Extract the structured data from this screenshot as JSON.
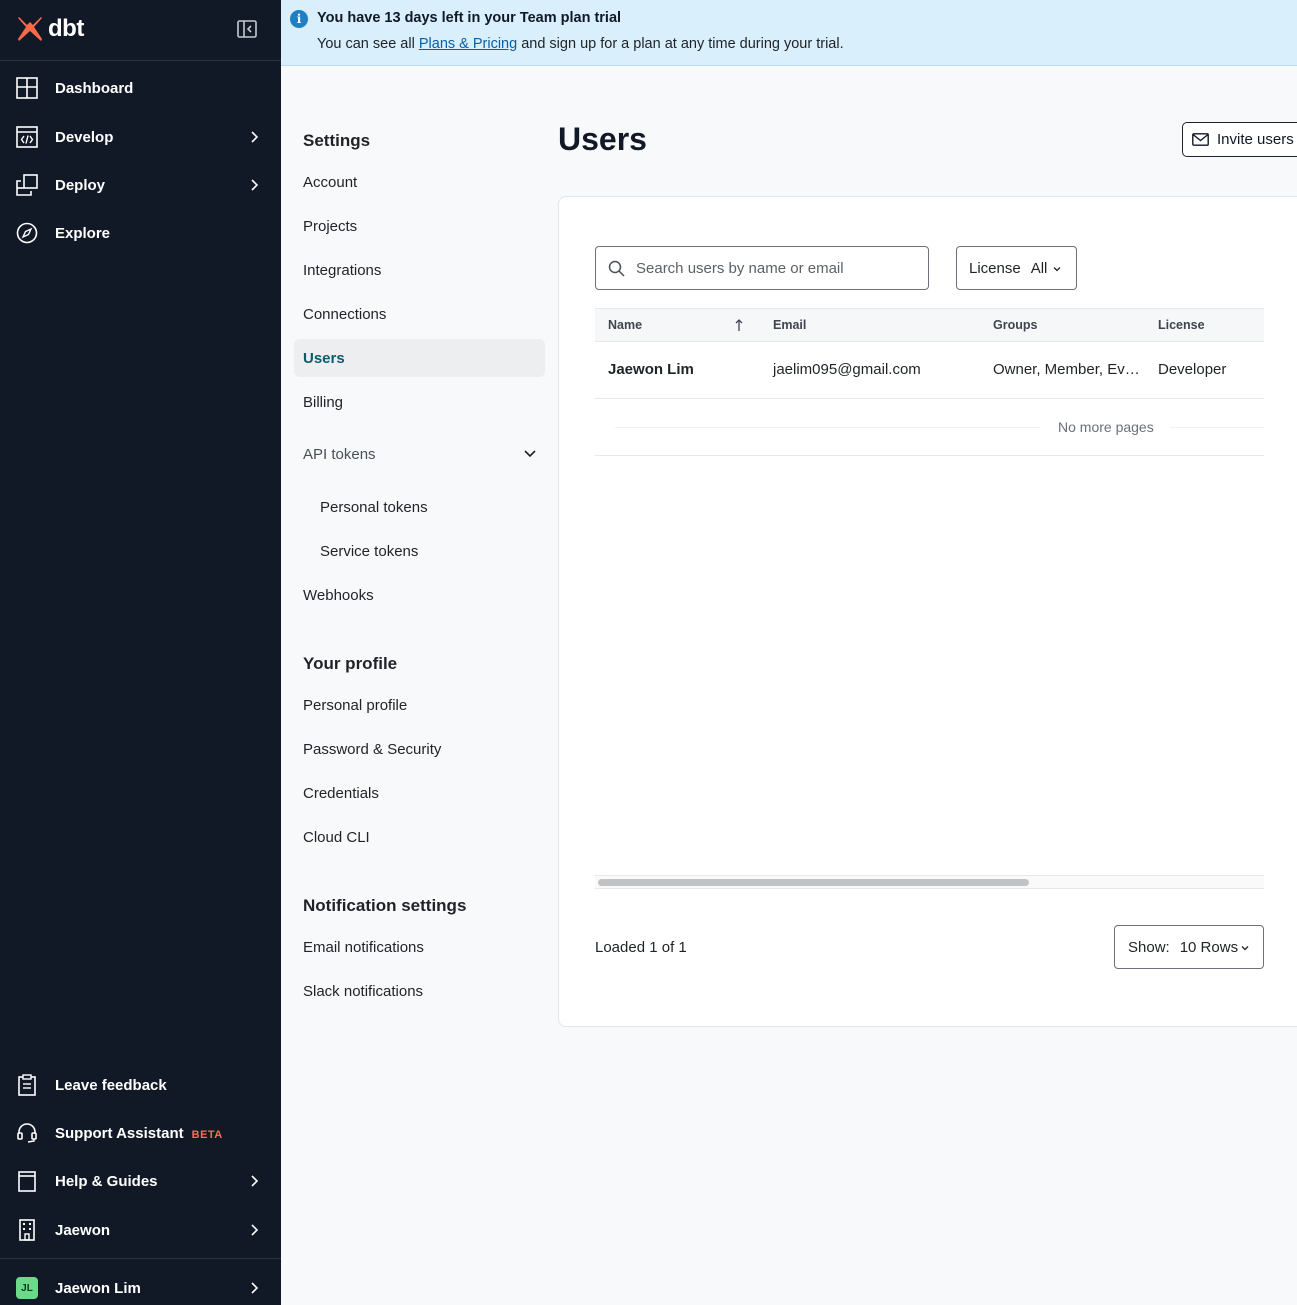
{
  "brand": {
    "name": "dbt",
    "accent": "#ff694a"
  },
  "sidebar": {
    "top_items": [
      {
        "label": "Dashboard",
        "icon": "dashboard-icon",
        "has_chevron": false
      },
      {
        "label": "Develop",
        "icon": "code-icon",
        "has_chevron": true
      },
      {
        "label": "Deploy",
        "icon": "deploy-icon",
        "has_chevron": true
      },
      {
        "label": "Explore",
        "icon": "compass-icon",
        "has_chevron": false
      }
    ],
    "bottom_items": [
      {
        "label": "Leave feedback",
        "icon": "clipboard-icon"
      },
      {
        "label": "Support Assistant",
        "icon": "headset-icon",
        "badge": "BETA"
      },
      {
        "label": "Help & Guides",
        "icon": "book-icon"
      },
      {
        "label": "Jaewon",
        "icon": "building-icon"
      }
    ],
    "user": {
      "initials": "JL",
      "name": "Jaewon Lim"
    }
  },
  "banner": {
    "title": "You have 13 days left in your Team plan trial",
    "text_before": "You can see all ",
    "link": "Plans & Pricing",
    "text_after": " and sign up for a plan at any time during your trial.",
    "color": "#d9effb"
  },
  "settings_nav": {
    "settings_heading": "Settings",
    "items": {
      "account": "Account",
      "projects": "Projects",
      "integrations": "Integrations",
      "connections": "Connections",
      "users": "Users",
      "billing": "Billing",
      "api_tokens": "API tokens",
      "personal_tokens": "Personal tokens",
      "service_tokens": "Service tokens",
      "webhooks": "Webhooks"
    },
    "profile_heading": "Your profile",
    "profile_items": {
      "personal_profile": "Personal profile",
      "password_security": "Password & Security",
      "credentials": "Credentials",
      "cloud_cli": "Cloud CLI"
    },
    "notifications_heading": "Notification settings",
    "notification_items": {
      "email": "Email notifications",
      "slack": "Slack notifications"
    }
  },
  "main": {
    "title": "Users",
    "invite_button": "Invite users",
    "search_placeholder": "Search users by name or email",
    "license_filter": {
      "label": "License",
      "value": "All"
    },
    "table": {
      "columns": [
        "Name",
        "Email",
        "Groups",
        "License"
      ],
      "rows": [
        {
          "name": "Jaewon Lim",
          "email": "jaelim095@gmail.com",
          "groups": "Owner, Member, Ev…",
          "license": "Developer"
        }
      ],
      "end_text": "No more pages"
    },
    "loaded_text": "Loaded 1 of 1",
    "rows_select": {
      "label": "Show:",
      "value": "10 Rows"
    }
  }
}
